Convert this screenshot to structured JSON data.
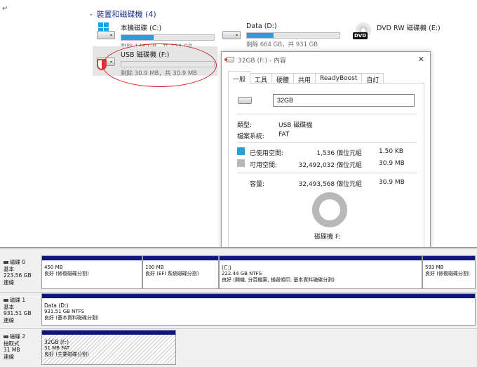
{
  "explorer": {
    "return_mark": "↵",
    "section_title": "裝置和磁碟機 (4)",
    "drives": [
      {
        "name": "本機磁碟 (C:)",
        "free_text": "剩餘 146 GB，共 223 GB",
        "used_fraction": 0.35,
        "icon": "windows-drive-icon"
      },
      {
        "name": "Data (D:)",
        "free_text": "剩餘 664 GB，共 931 GB",
        "used_fraction": 0.29,
        "icon": "hard-drive-icon"
      },
      {
        "name": "DVD RW 磁碟機 (E:)",
        "icon": "dvd-drive-icon",
        "dvd_label": "DVD"
      },
      {
        "name": "USB 磁碟機 (F:)",
        "free_text": "剩餘 30.9 MB，共 30.9 MB",
        "used_fraction": 0.0,
        "icon": "usb-drive-icon"
      }
    ]
  },
  "properties": {
    "title": "32GB (F:) - 內容",
    "close_glyph": "✕",
    "tabs": [
      "一般",
      "工具",
      "硬體",
      "共用",
      "ReadyBoost",
      "自訂"
    ],
    "active_tab": 0,
    "volume_name": "32GB",
    "type_label": "類型:",
    "type_value": "USB 磁碟機",
    "fs_label": "檔案系統:",
    "fs_value": "FAT",
    "used_label": "已使用空間:",
    "used_bytes": "1,536 個位元組",
    "used_size": "1.50 KB",
    "free_label": "可用空間:",
    "free_bytes": "32,492,032 個位元組",
    "free_size": "30.9 MB",
    "capacity_label": "容量:",
    "capacity_bytes": "32,493,568 個位元組",
    "capacity_size": "30.9 MB",
    "drive_caption": "磁碟機 F:",
    "used_color": "#26a0da",
    "free_color": "#b8b8b8"
  },
  "disk_management": {
    "disks": [
      {
        "label": [
          "磁碟 0",
          "基本",
          "223.56 GB",
          "連線"
        ],
        "partitions": [
          {
            "title": "",
            "lines": [
              "450 MB",
              "良好 (修復磁碟分割)"
            ]
          },
          {
            "title": "",
            "lines": [
              "100 MB",
              "良好 (EFI 系統磁碟分割)"
            ]
          },
          {
            "title": "(C:)",
            "lines": [
              "222.44 GB NTFS",
              "良好 (開機, 分頁檔案, 損毀傾印, 基本資料磁碟分割)"
            ]
          },
          {
            "title": "",
            "lines": [
              "593 MB",
              "良好 (修復磁碟分割)"
            ]
          }
        ]
      },
      {
        "label": [
          "磁碟 1",
          "基本",
          "931.51 GB",
          "連線"
        ],
        "partitions": [
          {
            "title": "Data (D:)",
            "lines": [
              "931.51 GB NTFS",
              "良好 (基本資料磁碟分割)"
            ]
          }
        ]
      },
      {
        "label": [
          "磁碟 2",
          "抽取式",
          "31 MB",
          "連線"
        ],
        "partitions": [
          {
            "title": "32GB (F:)",
            "lines": [
              "31 MB FAT",
              "良好 (主要磁碟分割)"
            ]
          }
        ]
      }
    ]
  }
}
